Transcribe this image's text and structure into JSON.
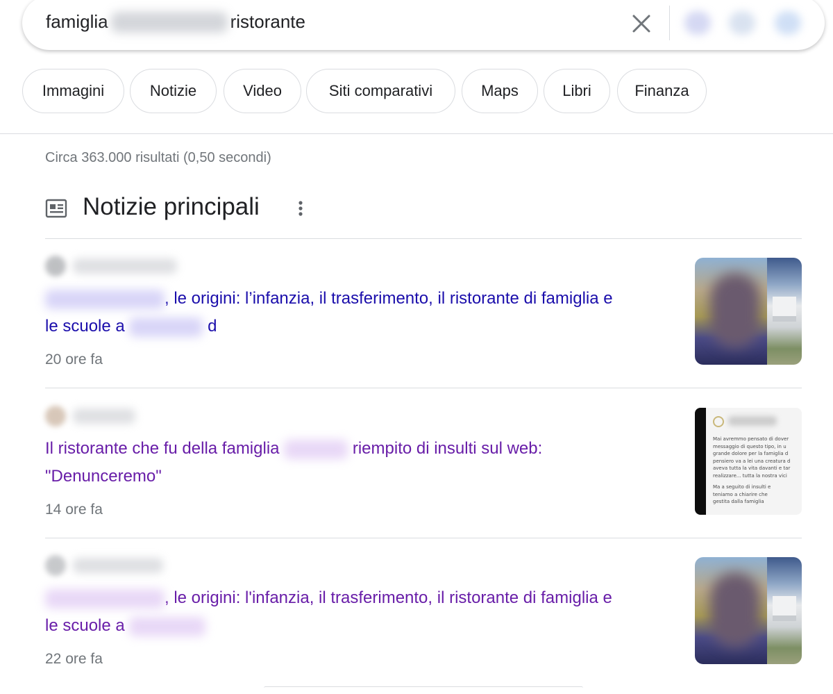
{
  "search": {
    "query_start": "famiglia",
    "query_end": "ristorante"
  },
  "chips": [
    {
      "label": "Immagini"
    },
    {
      "label": "Notizie"
    },
    {
      "label": "Video"
    },
    {
      "label": "Siti comparativi"
    },
    {
      "label": "Maps"
    },
    {
      "label": "Libri"
    },
    {
      "label": "Finanza"
    }
  ],
  "stats": "Circa 363.000 risultati (0,50 secondi)",
  "section": {
    "title": "Notizie principali",
    "icon": "newspaper-icon"
  },
  "articles": [
    {
      "headline_part1": ", le origini: l’infanzia, il trasferimento, il ristorante di famiglia e",
      "headline_part2": "le scuole a",
      "headline_part3": "d",
      "age": "20 ore fa",
      "link_color": "#1a0dab"
    },
    {
      "headline_part1": "Il ristorante che fu della famiglia",
      "headline_part2": "riempito di insulti sul web:",
      "headline_part3": "\"Denunceremo\"",
      "age": "14 ore fa",
      "link_color": "#681da8",
      "thumb_text": [
        "Mai avremmo pensato di dover",
        "messaggio di questo tipo, in u",
        "grande dolore per la famiglia d",
        "pensiero va a lei una creatura d",
        "aveva tutta la vita davanti e tar",
        "realizzare... tutta la nostra vici",
        "Ma a seguito di insulti e",
        "teniamo a chiarire che",
        "gestita dalla famiglia"
      ]
    },
    {
      "headline_part1": ", le origini: l'infanzia, il trasferimento, il ristorante di famiglia e",
      "headline_part2": "le scuole a",
      "age": "22 ore fa",
      "link_color": "#681da8"
    }
  ]
}
